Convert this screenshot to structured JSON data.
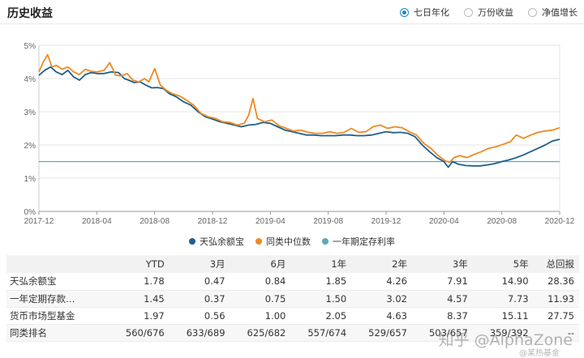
{
  "header": {
    "title": "历史收益",
    "tabs": [
      {
        "label": "七日年化",
        "selected": true
      },
      {
        "label": "万份收益",
        "selected": false
      },
      {
        "label": "净值增长",
        "selected": false
      }
    ]
  },
  "colors": {
    "fund": "#1f5f8b",
    "median": "#ef8a23",
    "deposit": "#5fa8b5",
    "accent": "#1e88c9"
  },
  "chart_data": {
    "type": "line",
    "ylim": [
      0,
      5
    ],
    "yticks": [
      "0%",
      "1%",
      "2%",
      "3%",
      "4%",
      "5%"
    ],
    "xticks": [
      "2017-12",
      "2018-04",
      "2018-08",
      "2018-12",
      "2019-04",
      "2019-08",
      "2019-12",
      "2020-04",
      "2020-08",
      "2020-12"
    ],
    "x_range": [
      0,
      36
    ],
    "series": [
      {
        "name": "天弘余额宝",
        "color": "#1f5f8b",
        "points": [
          [
            0,
            4.1
          ],
          [
            0.4,
            4.25
          ],
          [
            0.8,
            4.35
          ],
          [
            1.2,
            4.2
          ],
          [
            1.6,
            4.12
          ],
          [
            2.0,
            4.25
          ],
          [
            2.4,
            4.05
          ],
          [
            2.8,
            3.95
          ],
          [
            3.2,
            4.12
          ],
          [
            3.6,
            4.18
          ],
          [
            4.0,
            4.15
          ],
          [
            4.5,
            4.15
          ],
          [
            5.0,
            4.2
          ],
          [
            5.5,
            4.18
          ],
          [
            5.9,
            4.0
          ],
          [
            6.2,
            3.95
          ],
          [
            6.6,
            3.88
          ],
          [
            7.0,
            3.9
          ],
          [
            7.4,
            3.8
          ],
          [
            7.8,
            3.72
          ],
          [
            8.2,
            3.73
          ],
          [
            8.6,
            3.7
          ],
          [
            9.0,
            3.55
          ],
          [
            9.5,
            3.45
          ],
          [
            10.0,
            3.3
          ],
          [
            10.5,
            3.2
          ],
          [
            11.0,
            3.0
          ],
          [
            11.5,
            2.85
          ],
          [
            12.0,
            2.78
          ],
          [
            12.5,
            2.7
          ],
          [
            13.0,
            2.65
          ],
          [
            13.5,
            2.6
          ],
          [
            14.0,
            2.55
          ],
          [
            14.5,
            2.6
          ],
          [
            15.0,
            2.62
          ],
          [
            15.5,
            2.68
          ],
          [
            16.0,
            2.65
          ],
          [
            16.5,
            2.55
          ],
          [
            17.0,
            2.45
          ],
          [
            17.5,
            2.4
          ],
          [
            18.0,
            2.35
          ],
          [
            18.5,
            2.3
          ],
          [
            19.0,
            2.3
          ],
          [
            19.5,
            2.28
          ],
          [
            20.0,
            2.28
          ],
          [
            20.5,
            2.28
          ],
          [
            21.0,
            2.3
          ],
          [
            21.5,
            2.3
          ],
          [
            22.0,
            2.28
          ],
          [
            22.5,
            2.28
          ],
          [
            23.0,
            2.3
          ],
          [
            23.5,
            2.35
          ],
          [
            24.0,
            2.4
          ],
          [
            24.5,
            2.37
          ],
          [
            25.0,
            2.38
          ],
          [
            25.5,
            2.35
          ],
          [
            26.0,
            2.25
          ],
          [
            26.5,
            2.0
          ],
          [
            27.0,
            1.8
          ],
          [
            27.5,
            1.62
          ],
          [
            28.0,
            1.5
          ],
          [
            28.3,
            1.33
          ],
          [
            28.6,
            1.5
          ],
          [
            29.0,
            1.42
          ],
          [
            29.5,
            1.38
          ],
          [
            30.0,
            1.37
          ],
          [
            30.5,
            1.37
          ],
          [
            31.0,
            1.4
          ],
          [
            31.5,
            1.44
          ],
          [
            32.0,
            1.5
          ],
          [
            32.5,
            1.55
          ],
          [
            33.0,
            1.62
          ],
          [
            33.5,
            1.7
          ],
          [
            34.0,
            1.8
          ],
          [
            34.5,
            1.9
          ],
          [
            35.0,
            2.0
          ],
          [
            35.5,
            2.12
          ],
          [
            36.0,
            2.17
          ]
        ]
      },
      {
        "name": "同类中位数",
        "color": "#ef8a23",
        "points": [
          [
            0,
            4.2
          ],
          [
            0.3,
            4.5
          ],
          [
            0.6,
            4.72
          ],
          [
            0.9,
            4.35
          ],
          [
            1.2,
            4.4
          ],
          [
            1.6,
            4.28
          ],
          [
            2.0,
            4.35
          ],
          [
            2.4,
            4.2
          ],
          [
            2.8,
            4.12
          ],
          [
            3.2,
            4.28
          ],
          [
            3.6,
            4.22
          ],
          [
            4.0,
            4.2
          ],
          [
            4.5,
            4.25
          ],
          [
            4.9,
            4.48
          ],
          [
            5.3,
            4.1
          ],
          [
            5.7,
            4.08
          ],
          [
            6.1,
            4.15
          ],
          [
            6.5,
            3.95
          ],
          [
            6.9,
            3.9
          ],
          [
            7.3,
            4.0
          ],
          [
            7.6,
            3.9
          ],
          [
            8.0,
            4.3
          ],
          [
            8.4,
            3.8
          ],
          [
            8.8,
            3.65
          ],
          [
            9.2,
            3.55
          ],
          [
            9.7,
            3.48
          ],
          [
            10.2,
            3.35
          ],
          [
            10.7,
            3.2
          ],
          [
            11.2,
            2.95
          ],
          [
            11.7,
            2.85
          ],
          [
            12.2,
            2.8
          ],
          [
            12.7,
            2.7
          ],
          [
            13.2,
            2.68
          ],
          [
            13.7,
            2.6
          ],
          [
            14.2,
            2.65
          ],
          [
            14.5,
            2.9
          ],
          [
            14.8,
            3.4
          ],
          [
            15.1,
            2.8
          ],
          [
            15.6,
            2.7
          ],
          [
            16.1,
            2.75
          ],
          [
            16.6,
            2.58
          ],
          [
            17.1,
            2.5
          ],
          [
            17.6,
            2.42
          ],
          [
            18.1,
            2.45
          ],
          [
            18.6,
            2.38
          ],
          [
            19.1,
            2.35
          ],
          [
            19.6,
            2.35
          ],
          [
            20.1,
            2.4
          ],
          [
            20.6,
            2.35
          ],
          [
            21.1,
            2.38
          ],
          [
            21.6,
            2.5
          ],
          [
            22.1,
            2.38
          ],
          [
            22.6,
            2.4
          ],
          [
            23.1,
            2.55
          ],
          [
            23.6,
            2.6
          ],
          [
            24.1,
            2.5
          ],
          [
            24.6,
            2.55
          ],
          [
            25.1,
            2.52
          ],
          [
            25.6,
            2.4
          ],
          [
            26.1,
            2.3
          ],
          [
            26.6,
            2.05
          ],
          [
            27.1,
            1.9
          ],
          [
            27.6,
            1.68
          ],
          [
            28.1,
            1.52
          ],
          [
            28.4,
            1.48
          ],
          [
            28.7,
            1.62
          ],
          [
            29.1,
            1.68
          ],
          [
            29.6,
            1.62
          ],
          [
            30.1,
            1.72
          ],
          [
            30.6,
            1.8
          ],
          [
            31.1,
            1.9
          ],
          [
            31.6,
            1.95
          ],
          [
            32.1,
            2.02
          ],
          [
            32.6,
            2.1
          ],
          [
            33.0,
            2.3
          ],
          [
            33.5,
            2.2
          ],
          [
            34.0,
            2.3
          ],
          [
            34.5,
            2.38
          ],
          [
            35.0,
            2.42
          ],
          [
            35.5,
            2.45
          ],
          [
            36.0,
            2.52
          ]
        ]
      },
      {
        "name": "一年期定存利率",
        "color": "#5fa8b5",
        "points": [
          [
            0,
            1.5
          ],
          [
            36,
            1.5
          ]
        ]
      }
    ]
  },
  "table": {
    "headers": [
      "",
      "YTD",
      "3月",
      "6月",
      "1年",
      "2年",
      "3年",
      "5年",
      "总回报"
    ],
    "rows": [
      [
        "天弘余额宝",
        "1.78",
        "0.47",
        "0.84",
        "1.85",
        "4.26",
        "7.91",
        "14.90",
        "28.36"
      ],
      [
        "一年定期存款…",
        "1.45",
        "0.37",
        "0.75",
        "1.50",
        "3.02",
        "4.57",
        "7.73",
        "11.93"
      ],
      [
        "货币市场型基金",
        "1.97",
        "0.56",
        "1.00",
        "2.05",
        "4.63",
        "8.37",
        "15.11",
        "27.75"
      ],
      [
        "同类排名",
        "560/676",
        "633/689",
        "625/682",
        "557/674",
        "529/657",
        "503/657",
        "359/392",
        "--"
      ]
    ]
  },
  "watermark": {
    "text": "知乎 @AlphaZone",
    "sub": "@某热基金"
  }
}
